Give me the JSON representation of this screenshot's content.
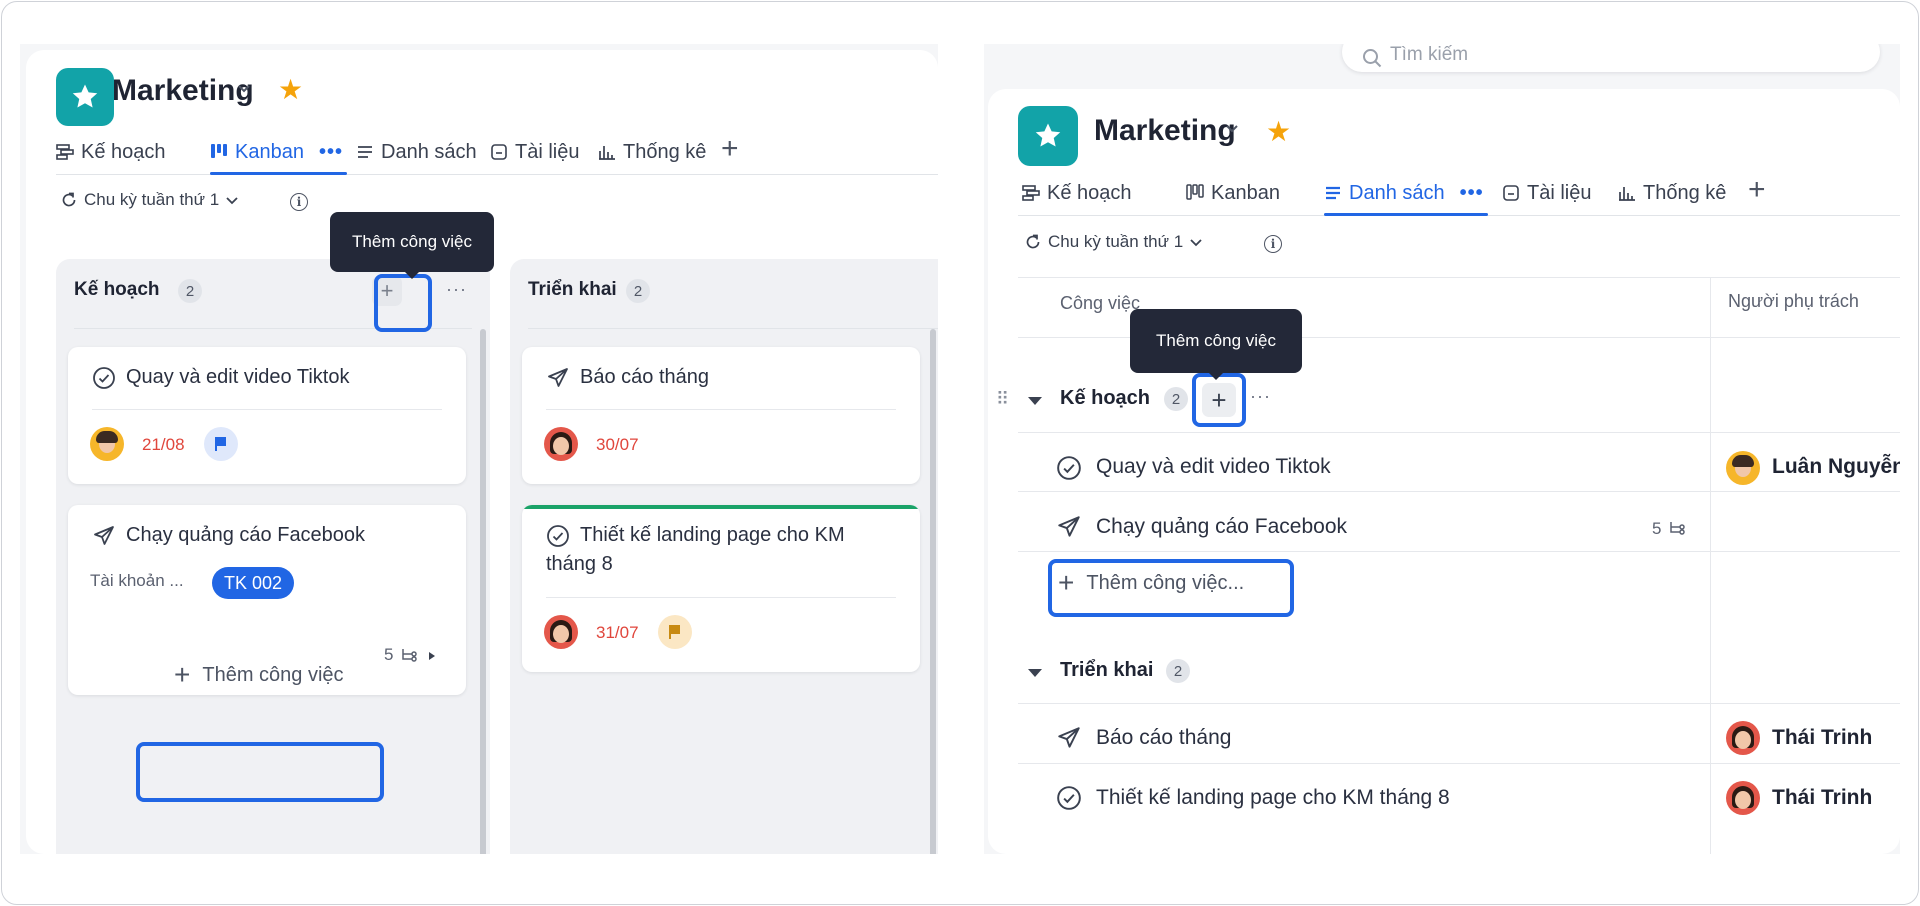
{
  "left": {
    "project": {
      "name": "Marketing"
    },
    "tabs": [
      {
        "label": "Kế hoạch",
        "icon": "gantt-icon"
      },
      {
        "label": "Kanban",
        "icon": "kanban-icon",
        "active": true
      },
      {
        "label": "Danh sách",
        "icon": "list-icon"
      },
      {
        "label": "Tài liệu",
        "icon": "document-icon"
      },
      {
        "label": "Thống kê",
        "icon": "bar-chart-icon"
      }
    ],
    "cycle": "Chu kỳ tuần thứ 1",
    "tooltip": "Thêm công việc",
    "columns": [
      {
        "title": "Kế hoạch",
        "count": "2",
        "cards": [
          {
            "title": "Quay và edit video Tiktok",
            "icon": "check-circle-icon",
            "date": "21/08",
            "priority": "blue-flag"
          },
          {
            "title": "Chạy quảng cáo Facebook",
            "icon": "paper-plane-icon",
            "field_label": "Tài khoản ...",
            "tag": "TK 002",
            "subtasks": "5"
          }
        ],
        "add_label": "Thêm công việc"
      },
      {
        "title": "Triển khai",
        "count": "2",
        "cards": [
          {
            "title": "Báo cáo tháng",
            "icon": "paper-plane-icon",
            "date": "30/07"
          },
          {
            "title_line1": "Thiết kế landing page cho KM",
            "title_line2": "tháng 8",
            "icon": "check-circle-icon",
            "date": "31/07",
            "priority": "yellow-flag"
          }
        ]
      }
    ]
  },
  "right": {
    "search": {
      "placeholder": "Tìm kiếm"
    },
    "project": {
      "name": "Marketing"
    },
    "tabs": [
      {
        "label": "Kế hoạch",
        "icon": "gantt-icon"
      },
      {
        "label": "Kanban",
        "icon": "kanban-icon"
      },
      {
        "label": "Danh sách",
        "icon": "list-icon",
        "active": true
      },
      {
        "label": "Tài liệu",
        "icon": "document-icon"
      },
      {
        "label": "Thống kê",
        "icon": "bar-chart-icon"
      }
    ],
    "cycle": "Chu kỳ tuần thứ 1",
    "columns": {
      "task": "Công việc",
      "assignee": "Người phụ trách"
    },
    "tooltip": "Thêm công việc",
    "groups": [
      {
        "title": "Kế hoạch",
        "count": "2",
        "rows": [
          {
            "title": "Quay và edit video Tiktok",
            "icon": "check-circle-icon",
            "assignee": "Luân Nguyễn"
          },
          {
            "title": "Chạy quảng cáo Facebook",
            "icon": "paper-plane-icon",
            "subtasks": "5",
            "assignee": ""
          }
        ],
        "add_label": "Thêm công việc..."
      },
      {
        "title": "Triển khai",
        "count": "2",
        "rows": [
          {
            "title": "Báo cáo tháng",
            "icon": "paper-plane-icon",
            "assignee": "Thái Trinh"
          },
          {
            "title": "Thiết kế landing page cho KM tháng 8",
            "icon": "check-circle-icon",
            "assignee": "Thái Trinh"
          }
        ]
      }
    ]
  },
  "colors": {
    "accent": "#2166e4",
    "brand": "#12a3a8",
    "star": "#f5a30b",
    "date": "#e0463c",
    "success": "#1aa368"
  }
}
